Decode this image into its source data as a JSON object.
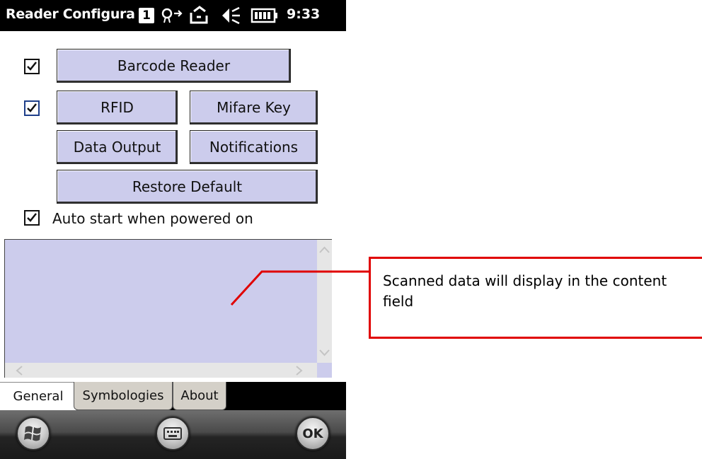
{
  "window": {
    "title": "Reader Configura",
    "sim_badge": "1",
    "clock": "9:33"
  },
  "settings": {
    "barcode_checked": true,
    "rfid_checked": true,
    "autostart_checked": true,
    "autostart_label": "Auto start when powered on"
  },
  "buttons": {
    "barcode_reader": "Barcode Reader",
    "rfid": "RFID",
    "mifare_key": "Mifare Key",
    "data_output": "Data Output",
    "notifications": "Notifications",
    "restore_default": "Restore Default"
  },
  "content_field": {
    "value": ""
  },
  "tabs": [
    {
      "label": "General",
      "active": true
    },
    {
      "label": "Symbologies",
      "active": false
    },
    {
      "label": "About",
      "active": false
    }
  ],
  "softkeys": {
    "ok_label": "OK"
  },
  "annotation": {
    "text": "Scanned data will display in the content field",
    "color": "#e00000"
  },
  "icons": [
    "connectivity-icon",
    "sync-icon",
    "volume-icon",
    "battery-icon",
    "windows-start-icon",
    "keyboard-icon"
  ]
}
